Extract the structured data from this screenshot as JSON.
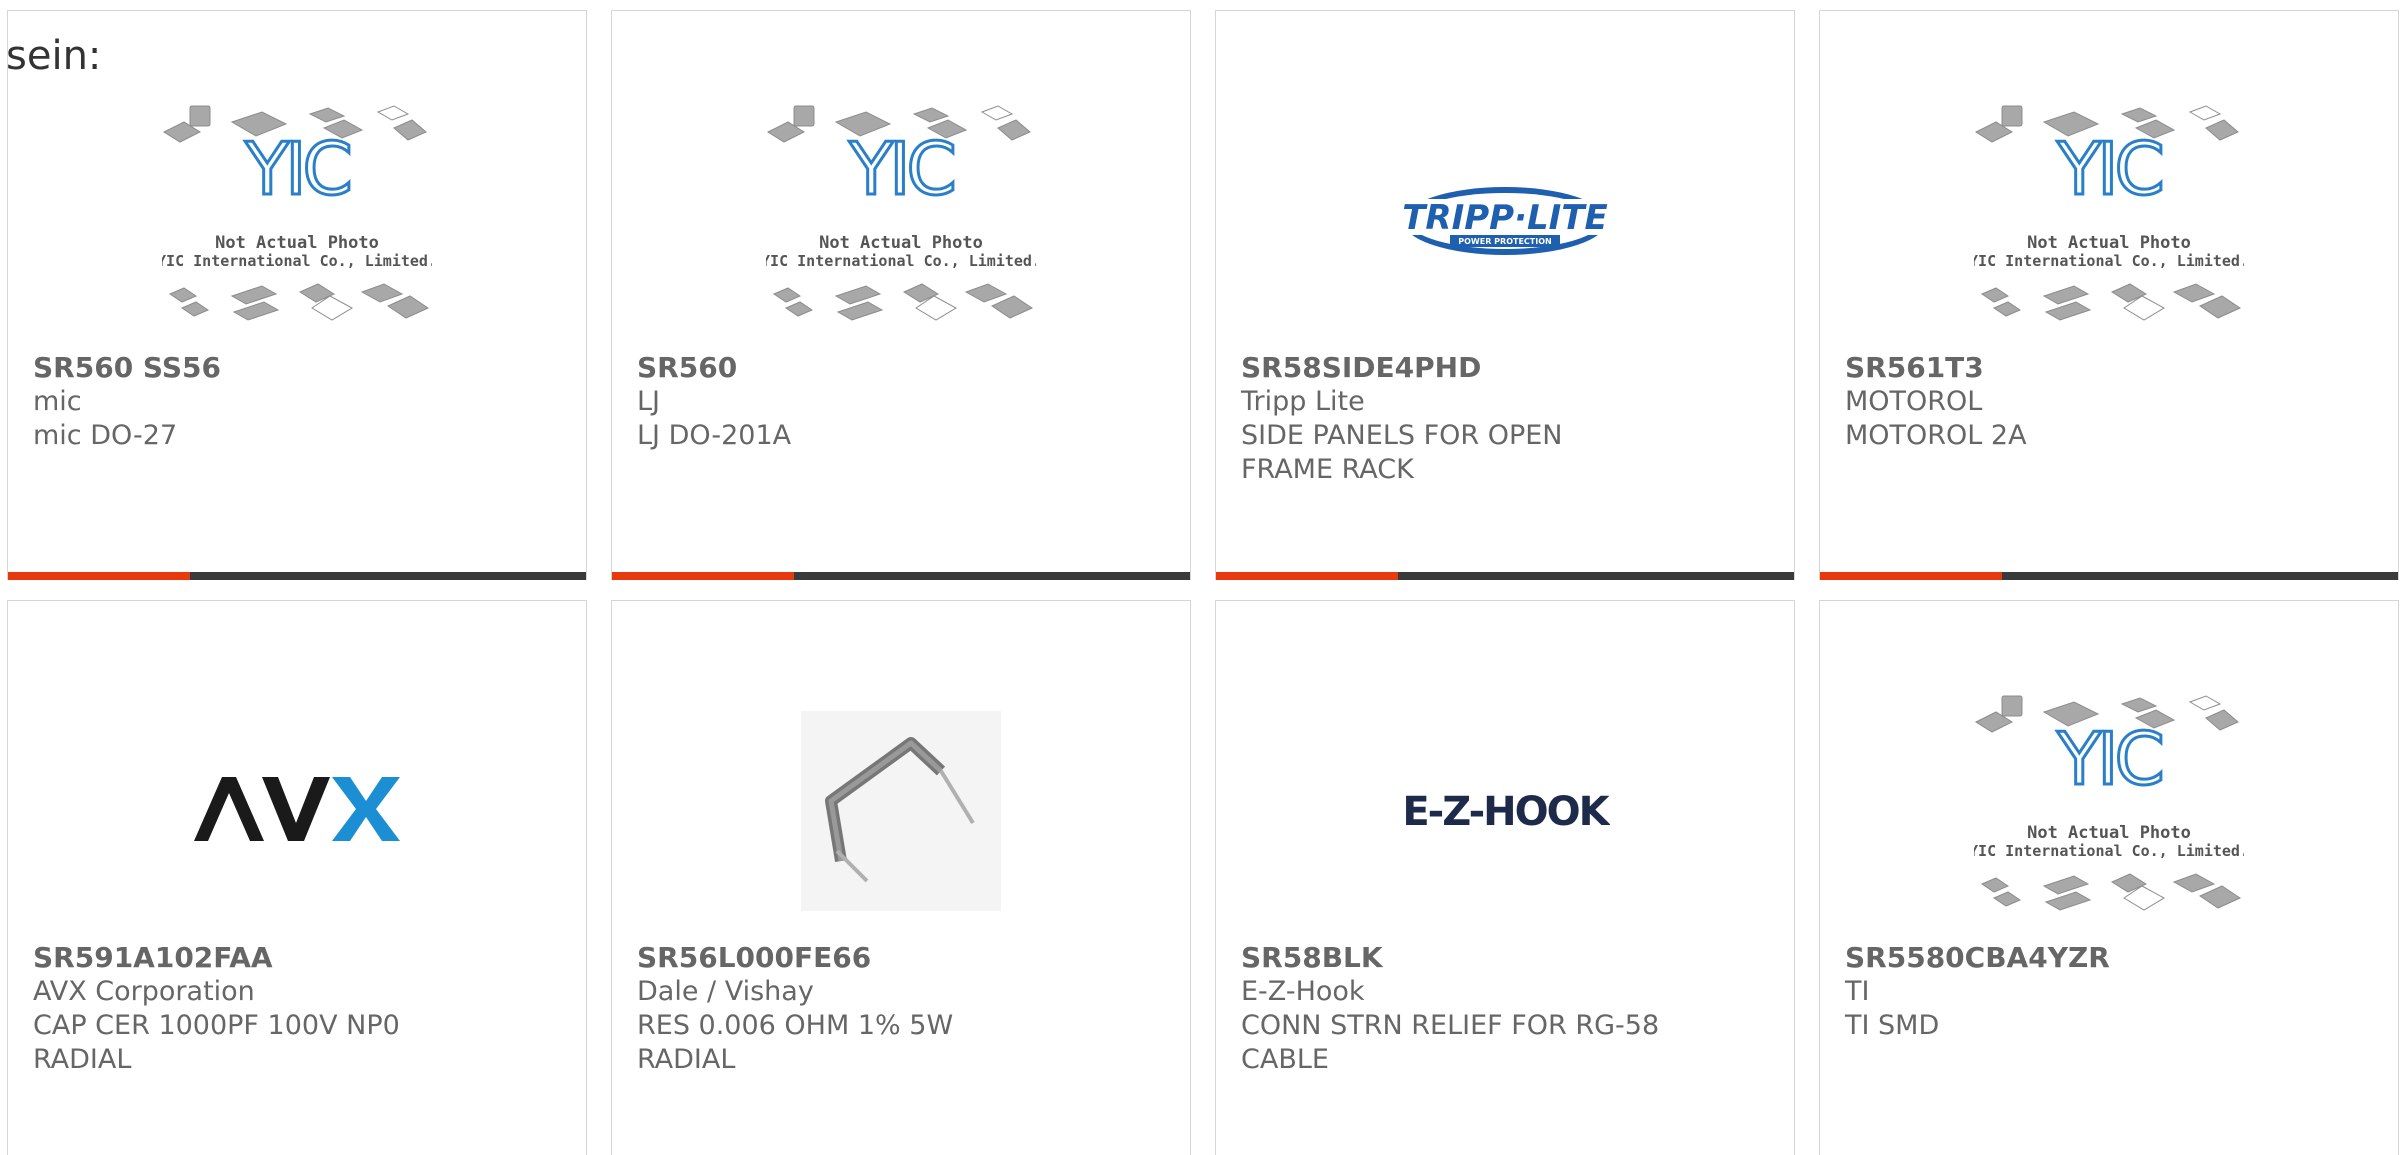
{
  "intro": "sein:",
  "brand": {
    "accent_color": "#e8380d",
    "bar_color": "#3a3a3a"
  },
  "placeholder_image": {
    "caption_line1": "Not Actual Photo",
    "caption_line2": "YIC International Co., Limited.",
    "logo_text": "YIC"
  },
  "brand_logos": {
    "tripp_lite": {
      "main": "TRIPP·LITE",
      "sub": "POWER PROTECTION"
    },
    "avx": "AVX",
    "ez_hook": "E-Z-HOOK"
  },
  "products": [
    {
      "part": "SR560 SS56",
      "maker": "mic",
      "desc": "mic DO-27",
      "image": "yic-placeholder"
    },
    {
      "part": "SR560",
      "maker": "LJ",
      "desc": "LJ DO-201A",
      "image": "yic-placeholder"
    },
    {
      "part": "SR58SIDE4PHD",
      "maker": "Tripp Lite",
      "desc": "SIDE PANELS FOR OPEN FRAME RACK",
      "image": "tripp-lite-logo"
    },
    {
      "part": "SR561T3",
      "maker": "MOTOROL",
      "desc": "MOTOROL 2A",
      "image": "yic-placeholder"
    },
    {
      "part": "SR591A102FAA",
      "maker": "AVX Corporation",
      "desc": "CAP CER 1000PF 100V NP0 RADIAL",
      "image": "avx-logo"
    },
    {
      "part": "SR56L000FE66",
      "maker": "Dale / Vishay",
      "desc": "RES 0.006 OHM 1% 5W RADIAL",
      "image": "resistor-photo"
    },
    {
      "part": "SR58BLK",
      "maker": "E-Z-Hook",
      "desc": "CONN STRN RELIEF FOR RG-58 CABLE",
      "image": "ez-hook-logo"
    },
    {
      "part": "SR5580CBA4YZR",
      "maker": "TI",
      "desc": "TI SMD",
      "image": "yic-placeholder"
    }
  ]
}
